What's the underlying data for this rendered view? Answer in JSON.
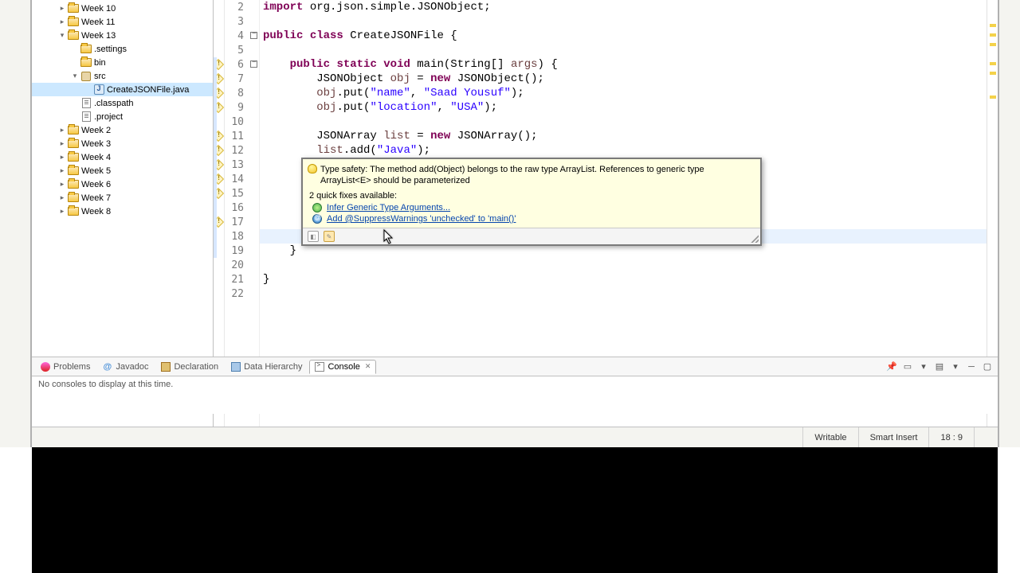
{
  "project_tree": {
    "items": [
      {
        "indent": 2,
        "twisty": "closed",
        "icon": "folder",
        "label": "Week 10"
      },
      {
        "indent": 2,
        "twisty": "closed",
        "icon": "folder",
        "label": "Week 11"
      },
      {
        "indent": 2,
        "twisty": "open",
        "icon": "folder",
        "label": "Week 13"
      },
      {
        "indent": 3,
        "twisty": "none",
        "icon": "folder",
        "label": ".settings"
      },
      {
        "indent": 3,
        "twisty": "none",
        "icon": "folder",
        "label": "bin"
      },
      {
        "indent": 3,
        "twisty": "open",
        "icon": "pkg",
        "label": "src"
      },
      {
        "indent": 4,
        "twisty": "none",
        "icon": "java",
        "label": "CreateJSONFile.java",
        "selected": true
      },
      {
        "indent": 3,
        "twisty": "none",
        "icon": "file",
        "label": ".classpath"
      },
      {
        "indent": 3,
        "twisty": "none",
        "icon": "file",
        "label": ".project"
      },
      {
        "indent": 2,
        "twisty": "closed",
        "icon": "folder",
        "label": "Week 2"
      },
      {
        "indent": 2,
        "twisty": "closed",
        "icon": "folder",
        "label": "Week 3"
      },
      {
        "indent": 2,
        "twisty": "closed",
        "icon": "folder",
        "label": "Week 4"
      },
      {
        "indent": 2,
        "twisty": "closed",
        "icon": "folder",
        "label": "Week 5"
      },
      {
        "indent": 2,
        "twisty": "closed",
        "icon": "folder",
        "label": "Week 6"
      },
      {
        "indent": 2,
        "twisty": "closed",
        "icon": "folder",
        "label": "Week 7"
      },
      {
        "indent": 2,
        "twisty": "closed",
        "icon": "folder",
        "label": "Week 8"
      }
    ]
  },
  "editor": {
    "first_line_number": 2,
    "last_line_number": 22,
    "warning_lines": [
      6,
      7,
      8,
      9,
      11,
      12,
      13,
      14,
      15,
      17
    ],
    "cursor_highlight_line": 18,
    "lines": {
      "2": [
        [
          "kw",
          "import"
        ],
        [
          "punc",
          " "
        ],
        [
          "id",
          "org.json.simple.JSONObject"
        ],
        [
          "punc",
          ";"
        ]
      ],
      "3": [],
      "4": [
        [
          "kw",
          "public"
        ],
        [
          "punc",
          " "
        ],
        [
          "kw",
          "class"
        ],
        [
          "punc",
          " "
        ],
        [
          "typ",
          "CreateJSONFile"
        ],
        [
          "punc",
          " {"
        ]
      ],
      "5": [],
      "6": [
        [
          "punc",
          "    "
        ],
        [
          "kw",
          "public"
        ],
        [
          "punc",
          " "
        ],
        [
          "kw",
          "static"
        ],
        [
          "punc",
          " "
        ],
        [
          "kw",
          "void"
        ],
        [
          "punc",
          " "
        ],
        [
          "id",
          "main"
        ],
        [
          "punc",
          "("
        ],
        [
          "typ",
          "String"
        ],
        [
          "punc",
          "[] "
        ],
        [
          "var",
          "args"
        ],
        [
          "punc",
          ") {"
        ]
      ],
      "7": [
        [
          "punc",
          "        "
        ],
        [
          "typ",
          "JSONObject"
        ],
        [
          "punc",
          " "
        ],
        [
          "var",
          "obj"
        ],
        [
          "punc",
          " = "
        ],
        [
          "kw",
          "new"
        ],
        [
          "punc",
          " "
        ],
        [
          "typ",
          "JSONObject"
        ],
        [
          "punc",
          "();"
        ]
      ],
      "8": [
        [
          "punc",
          "        "
        ],
        [
          "var",
          "obj"
        ],
        [
          "punc",
          ".put("
        ],
        [
          "str",
          "\"name\""
        ],
        [
          "punc",
          ", "
        ],
        [
          "str",
          "\"Saad Yousuf\""
        ],
        [
          "punc",
          ");"
        ]
      ],
      "9": [
        [
          "punc",
          "        "
        ],
        [
          "var",
          "obj"
        ],
        [
          "punc",
          ".put("
        ],
        [
          "str",
          "\"location\""
        ],
        [
          "punc",
          ", "
        ],
        [
          "str",
          "\"USA\""
        ],
        [
          "punc",
          ");"
        ]
      ],
      "10": [],
      "11": [
        [
          "punc",
          "        "
        ],
        [
          "typ",
          "JSONArray"
        ],
        [
          "punc",
          " "
        ],
        [
          "var",
          "list"
        ],
        [
          "punc",
          " = "
        ],
        [
          "kw",
          "new"
        ],
        [
          "punc",
          " "
        ],
        [
          "typ",
          "JSONArray"
        ],
        [
          "punc",
          "();"
        ]
      ],
      "12": [
        [
          "punc",
          "        "
        ],
        [
          "var",
          "list"
        ],
        [
          "punc",
          ".add("
        ],
        [
          "str",
          "\"Java\""
        ],
        [
          "punc",
          ");"
        ]
      ],
      "13": [],
      "14": [],
      "15": [],
      "16": [],
      "17": [],
      "18": [],
      "19": [
        [
          "punc",
          "    }"
        ]
      ],
      "20": [],
      "21": [
        [
          "punc",
          "}"
        ]
      ],
      "22": []
    }
  },
  "quickfix": {
    "message": "Type safety: The method add(Object) belongs to the raw type ArrayList. References to generic type ArrayList<E> should be parameterized",
    "fixes_header": "2 quick fixes available:",
    "fixes": [
      {
        "icon": "green",
        "label": "Infer Generic Type Arguments..."
      },
      {
        "icon": "ann",
        "label": "Add @SuppressWarnings 'unchecked' to 'main()'"
      }
    ]
  },
  "bottom_tabs": {
    "items": [
      {
        "id": "problems",
        "label": "Problems",
        "active": false
      },
      {
        "id": "javadoc",
        "label": "Javadoc",
        "active": false
      },
      {
        "id": "declaration",
        "label": "Declaration",
        "active": false
      },
      {
        "id": "datahier",
        "label": "Data Hierarchy",
        "active": false
      },
      {
        "id": "console",
        "label": "Console",
        "active": true
      }
    ],
    "content": "No consoles to display at this time."
  },
  "statusbar": {
    "writable": "Writable",
    "insert_mode": "Smart Insert",
    "cursor_pos": "18 : 9"
  }
}
